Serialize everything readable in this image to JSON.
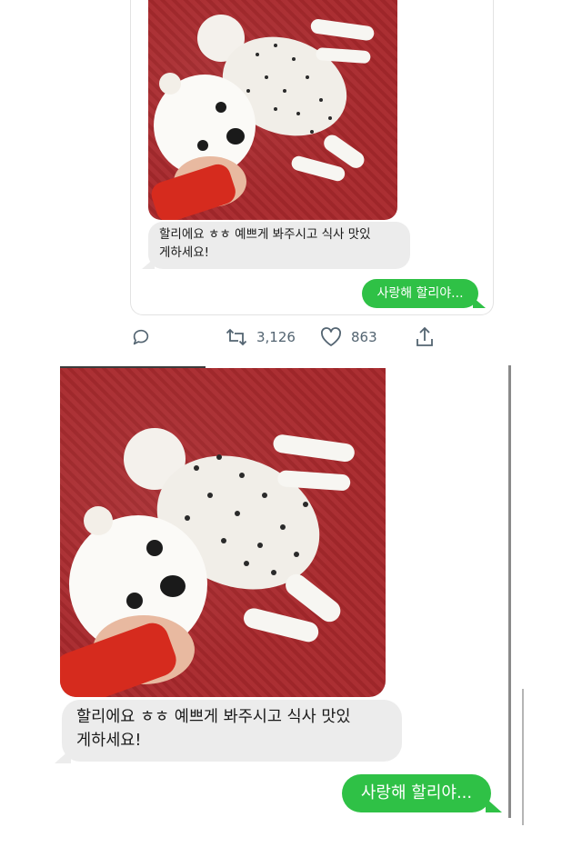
{
  "tweet_card": {
    "message_in": {
      "line1": "할리에요 ㅎㅎ 예쁘게 봐주시고 식사 맛있",
      "line2": "게하세요!"
    },
    "message_out": "사랑해 할리야..."
  },
  "actions": {
    "reply_icon": "comment-bubble-icon",
    "retweet_icon": "retweet-icon",
    "retweet_count": "3,126",
    "like_icon": "heart-icon",
    "like_count": "863",
    "share_icon": "share-upload-icon"
  },
  "chat": {
    "message_in": {
      "line1": "할리에요 ㅎㅎ 예쁘게 봐주시고 식사 맛있",
      "line2": "게하세요!"
    },
    "message_out": "사랑해 할리야..."
  },
  "colors": {
    "bubble_out": "#2fc146",
    "bubble_in": "#ececec",
    "blanket": "#a8282c",
    "action_gray": "#536471"
  }
}
